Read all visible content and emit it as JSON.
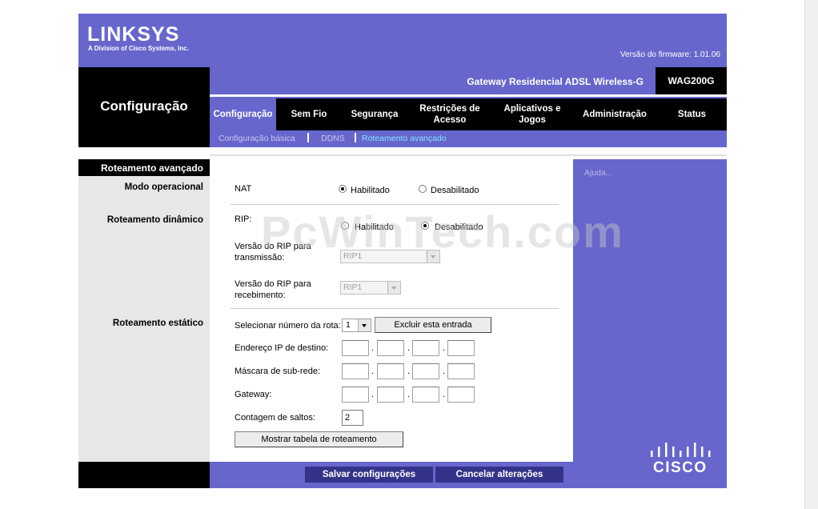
{
  "brand": {
    "logo": "LINKSYS",
    "subtitle": "A Division of Cisco Systems, Inc.",
    "firmware": "Versão do firmware: 1.01.06",
    "footer_logo": "CISCO"
  },
  "section_title": "Configuração",
  "product_name": "Gateway Residencial ADSL Wireless-G",
  "model": "WAG200G",
  "tabs": [
    {
      "label": "Configuração"
    },
    {
      "label": "Sem Fio"
    },
    {
      "label": "Segurança"
    },
    {
      "label": "Restrições de Acesso"
    },
    {
      "label": "Aplicativos e Jogos"
    },
    {
      "label": "Administração"
    },
    {
      "label": "Status"
    }
  ],
  "subtabs": [
    {
      "label": "Configuração básica"
    },
    {
      "label": "DDNS"
    },
    {
      "label": "Roteamento avançado"
    }
  ],
  "sidebar": {
    "title": "Roteamento avançado",
    "modo": "Modo operacional",
    "dinamico": "Roteamento dinâmico",
    "estatico": "Roteamento estático"
  },
  "help": "Ajuda...",
  "nat": {
    "label": "NAT",
    "enabled": "Habilitado",
    "disabled": "Desabilitado"
  },
  "rip": {
    "label": "RIP:",
    "enabled": "Habilitado",
    "disabled": "Desabilitado",
    "tx_label": "Versão do RIP para transmissão:",
    "tx_value": "RIP1",
    "rx_label": "Versão do RIP para recebimento:",
    "rx_value": "RIP1"
  },
  "static": {
    "route_label": "Selecionar número da rota:",
    "route_value": "1",
    "delete_button": "Excluir esta entrada",
    "dest_label": "Endereço IP de destino:",
    "mask_label": "Máscara de sub-rede:",
    "gateway_label": "Gateway:",
    "hops_label": "Contagem de saltos:",
    "hops_value": "2",
    "show_table_button": "Mostrar tabela de roteamento"
  },
  "footer": {
    "save": "Salvar configurações",
    "cancel": "Cancelar alterações"
  },
  "watermark": "PcWinTech.com"
}
